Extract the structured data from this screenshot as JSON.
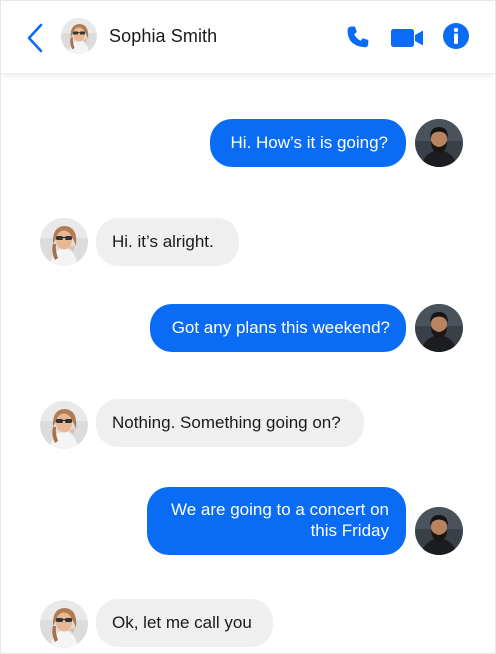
{
  "header": {
    "contact_name": "Sophia Smith",
    "icons": [
      "back-chevron-icon",
      "phone-icon",
      "video-camera-icon",
      "info-icon"
    ]
  },
  "colors": {
    "accent": "#0a6cf5",
    "outgoing_bubble": "#0a6cf5",
    "incoming_bubble": "#efefef"
  },
  "messages": [
    {
      "from": "me",
      "text": "Hi. How’s it is going?"
    },
    {
      "from": "contact",
      "text": "Hi. it’s alright."
    },
    {
      "from": "me",
      "text": "Got any plans this weekend?"
    },
    {
      "from": "contact",
      "text": "Nothing. Something going on?"
    },
    {
      "from": "me",
      "text": "We are going to a concert on this Friday"
    },
    {
      "from": "contact",
      "text": "Ok, let me call you"
    }
  ]
}
